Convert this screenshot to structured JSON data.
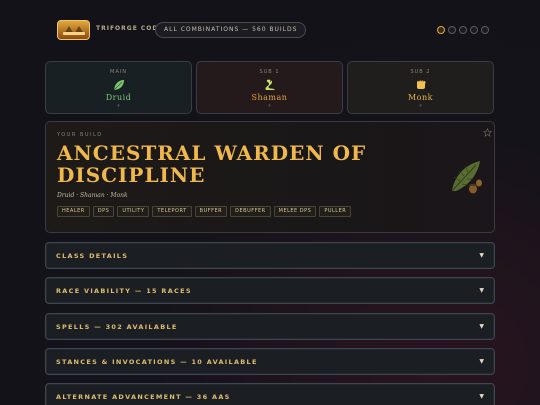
{
  "header": {
    "logo_icon": "triforce-logo-icon",
    "brand": "TRIFORGE CODEX",
    "all_combinations": "ALL COMBINATIONS — 560 BUILDS",
    "dots": [
      true,
      false,
      false,
      false,
      false
    ]
  },
  "slots": [
    {
      "kicker": "MAIN",
      "name": "Druid",
      "icon": "leaf-icon",
      "color": "#7cc970"
    },
    {
      "kicker": "SUB 1",
      "name": "Shaman",
      "icon": "serpent-icon",
      "color": "#e4a23a"
    },
    {
      "kicker": "SUB 2",
      "name": "Monk",
      "icon": "fist-icon",
      "color": "#e3b548"
    }
  ],
  "build": {
    "kicker": "YOUR BUILD",
    "title": "Ancestral Warden of Discipline",
    "combo": "Druid · Shaman · Monk",
    "tags": [
      "HEALER",
      "DPS",
      "UTILITY",
      "TELEPORT",
      "BUFFER",
      "DEBUFFER",
      "MELEE DPS",
      "PULLER"
    ],
    "favorite_icon": "star-icon",
    "emblem_icon": "oak-leaf-icon"
  },
  "sections": [
    {
      "label": "CLASS DETAILS"
    },
    {
      "label": "RACE VIABILITY — 15 RACES"
    },
    {
      "label": "SPELLS — 302 AVAILABLE"
    },
    {
      "label": "STANCES & INVOCATIONS — 10 AVAILABLE"
    },
    {
      "label": "ALTERNATE ADVANCEMENT — 36 AAS"
    }
  ],
  "colors": {
    "accent": "#f0b84a",
    "druid": "#7cc970",
    "shaman": "#e4a23a",
    "monk": "#e3b548"
  }
}
